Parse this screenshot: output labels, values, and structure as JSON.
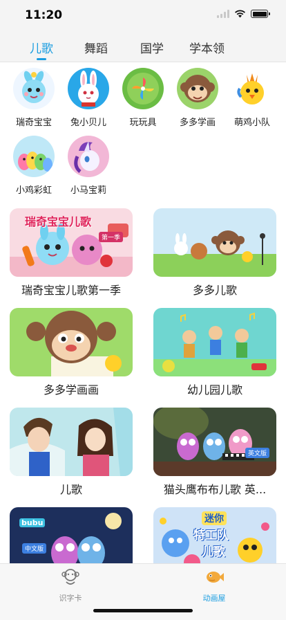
{
  "status_bar": {
    "time": "11:20"
  },
  "top_tabs": [
    {
      "label": "儿歌",
      "active": true
    },
    {
      "label": "舞蹈",
      "active": false
    },
    {
      "label": "国学",
      "active": false
    },
    {
      "label": "学本领",
      "active": false
    }
  ],
  "categories": [
    {
      "label": "瑞奇宝宝",
      "icon": "baby-riki-icon"
    },
    {
      "label": "兔小贝儿",
      "icon": "rabbit-icon"
    },
    {
      "label": "玩玩具",
      "icon": "toy-pinwheel-icon"
    },
    {
      "label": "多多学画",
      "icon": "monkey-icon"
    },
    {
      "label": "萌鸡小队",
      "icon": "chick-icon"
    },
    {
      "label": "小鸡彩虹",
      "icon": "rainbow-chicks-icon"
    },
    {
      "label": "小马宝莉",
      "icon": "pony-icon"
    }
  ],
  "cards": [
    {
      "title": "瑞奇宝宝儿歌第一季",
      "thumb_text": "瑞奇宝宝儿歌",
      "badge": "第一季"
    },
    {
      "title": "多多儿歌"
    },
    {
      "title": "多多学画画"
    },
    {
      "title": "幼儿园儿歌"
    },
    {
      "title": "儿歌"
    },
    {
      "title": "猫头鹰布布儿歌 英...",
      "badge": "英文版"
    },
    {
      "title": "",
      "badge": "中文版",
      "brand": "bubu"
    },
    {
      "title": "",
      "thumb_text_1": "迷你",
      "thumb_text_2": "特工队",
      "thumb_text_3": "儿歌"
    }
  ],
  "bottom_nav": [
    {
      "label": "识字卡",
      "icon": "monkey-outline-icon",
      "active": false
    },
    {
      "label": "动画屋",
      "icon": "fish-icon",
      "active": true
    }
  ],
  "colors": {
    "accent": "#1a9de0",
    "tab_bg": "#f4f4f4"
  }
}
